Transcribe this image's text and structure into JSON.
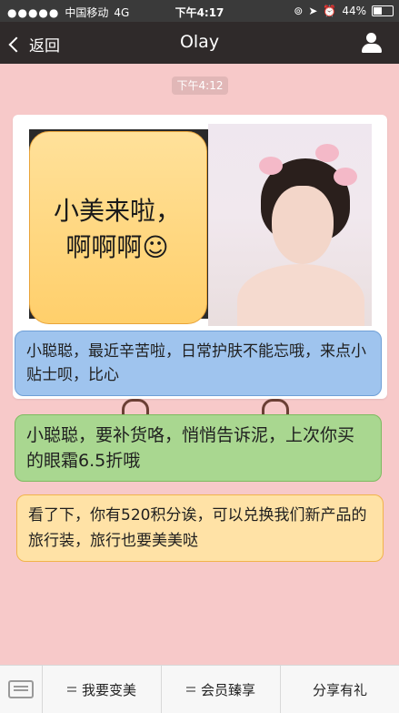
{
  "status": {
    "carrier": "中国移动",
    "network": "4G",
    "time": "下午4:17",
    "battery": "44%",
    "battery_level": 0.44
  },
  "nav": {
    "back_label": "返回",
    "title": "Olay"
  },
  "chat": {
    "timestamp": "下午4:12",
    "sticker_text_line1": "小美来啦，",
    "sticker_text_line2": "啊啊啊☺",
    "messages": [
      {
        "text": "小聪聪，最近辛苦啦，日常护肤不能忘哦，来点小贴士呗，比心"
      },
      {
        "text": "小聪聪，要补货咯，悄悄告诉泥，上次你买的眼霜6.5折哦"
      },
      {
        "text": "看了下，你有520积分诶，可以兑换我们新产品的旅行装，旅行也要美美哒"
      }
    ]
  },
  "bottom_menu": {
    "items": [
      "我要变美",
      "会员臻享",
      "分享有礼"
    ]
  },
  "colors": {
    "background": "#f7c9c9",
    "nav": "#2f2a2a",
    "bubble_blue": "#9fc4ee",
    "bubble_green": "#a9d790",
    "bubble_orange": "#ffe2a6"
  }
}
